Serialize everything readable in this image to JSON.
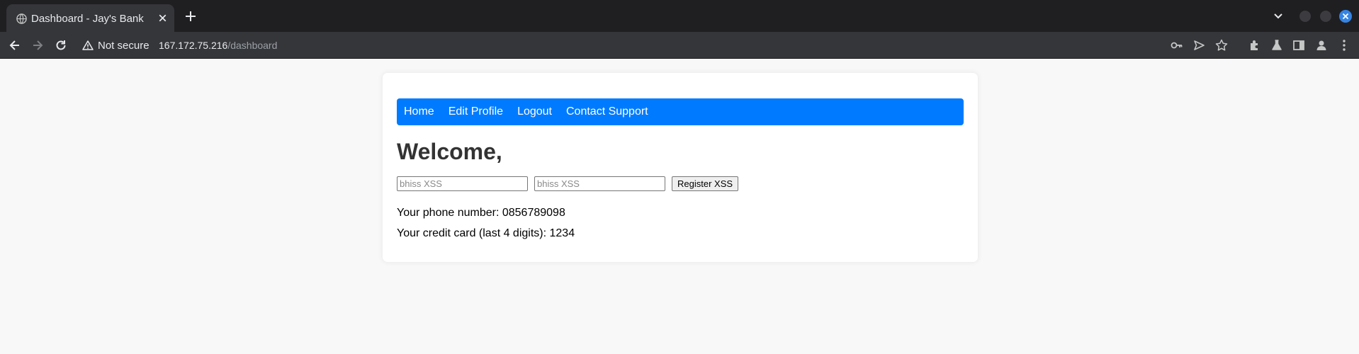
{
  "browser": {
    "tab_title": "Dashboard - Jay's Bank",
    "security_label": "Not secure",
    "url_host": "167.172.75.216",
    "url_path": "/dashboard"
  },
  "nav": {
    "items": [
      "Home",
      "Edit Profile",
      "Logout",
      "Contact Support"
    ]
  },
  "page": {
    "welcome": "Welcome,",
    "input1_placeholder": "bhiss XSS",
    "input2_placeholder": "bhiss XSS",
    "register_button": "Register XSS",
    "phone_line": "Your phone number: 0856789098",
    "card_line": "Your credit card (last 4 digits): 1234"
  },
  "colors": {
    "navbar": "#007bff",
    "chrome_dark": "#1f1f22",
    "chrome_toolbar": "#35363a",
    "page_bg": "#f8f8f8"
  }
}
